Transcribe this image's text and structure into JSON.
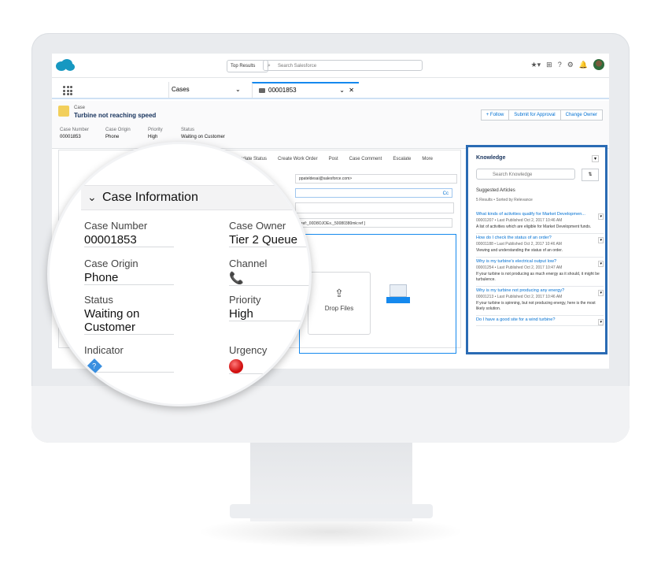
{
  "topbar": {
    "scope_label": "Top Results",
    "search_placeholder": "Search Salesforce",
    "icons": [
      "favorites-icon",
      "add-icon",
      "help-icon",
      "setup-icon",
      "notifications-icon",
      "avatar"
    ]
  },
  "nav": {
    "app_tab": "Cases",
    "active_tab": "00001853"
  },
  "record": {
    "object_label": "Case",
    "subject": "Turbine not reaching speed",
    "buttons": [
      "+ Follow",
      "Submit for Approval",
      "Change Owner"
    ],
    "fields": [
      {
        "label": "Case Number",
        "value": "00001853"
      },
      {
        "label": "Case Origin",
        "value": "Phone"
      },
      {
        "label": "Priority",
        "value": "High"
      },
      {
        "label": "Status",
        "value": "Waiting on Customer"
      }
    ]
  },
  "publisher": {
    "actions": [
      "Update Status",
      "Create Work Order",
      "Post",
      "Case Comment",
      "Escalate",
      "More"
    ],
    "email_to": "ppateldesai@salesforce.com>",
    "cc_label": "Cc",
    "ref_text": "[ ref:_00D8OJOEx._50080380mk:ref ]",
    "drop_label": "Drop Files"
  },
  "knowledge": {
    "title": "Knowledge",
    "search_placeholder": "Search Knowledge",
    "suggested_label": "Suggested Articles",
    "meta": "5 Results • Sorted by Relevance",
    "articles": [
      {
        "title": "What kinds of activities qualify for Market Developmen...",
        "meta": "00001207 • Last Published Oct 2, 2017 10:46 AM",
        "desc": "A list of activities which are eligible for Market Development funds."
      },
      {
        "title": "How do I check the status of an order?",
        "meta": "00001188 • Last Published Oct 2, 2017 10:46 AM",
        "desc": "Viewing and understanding the status of an order."
      },
      {
        "title": "Why is my turbine's electrical output low?",
        "meta": "00001254 • Last Published Oct 2, 2017 10:47 AM",
        "desc": "If your turbine is not producing as much energy as it should, it might be turbulence."
      },
      {
        "title": "Why is my turbine not producing any energy?",
        "meta": "00001213 • Last Published Oct 2, 2017 10:46 AM",
        "desc": "If your turbine is spinning, but not producing energy, here is the most likely solution."
      },
      {
        "title": "Do I have a good site for a wind turbine?",
        "meta": "",
        "desc": ""
      }
    ]
  },
  "lens": {
    "section_title": "Case Information",
    "fields": {
      "case_number": {
        "label": "Case Number",
        "value": "00001853"
      },
      "case_owner": {
        "label": "Case Owner",
        "value": "Tier 2 Queue"
      },
      "case_origin": {
        "label": "Case Origin",
        "value": "Phone"
      },
      "channel": {
        "label": "Channel",
        "icon": "phone-icon"
      },
      "status": {
        "label": "Status",
        "value": "Waiting on Customer"
      },
      "priority": {
        "label": "Priority",
        "value": "High"
      },
      "indicator": {
        "label": "Indicator",
        "icon": "diamond-icon"
      },
      "urgency": {
        "label": "Urgency",
        "icon": "red-dot-icon"
      }
    }
  },
  "colors": {
    "brand_blue": "#1589ee",
    "case_icon": "#f2cf5b",
    "knowledge_border": "#2a6bb4",
    "urgency_red": "#d11010"
  }
}
